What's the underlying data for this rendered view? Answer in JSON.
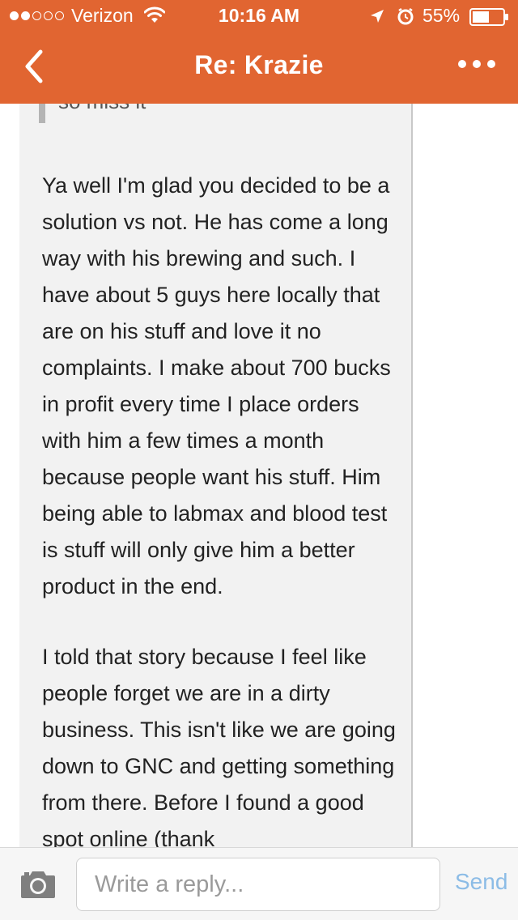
{
  "status_bar": {
    "signal_dots_filled": 2,
    "signal_dots_total": 5,
    "carrier": "Verizon",
    "time": "10:16 AM",
    "battery": "55%",
    "battery_level": 0.55
  },
  "nav": {
    "title": "Re: Krazie",
    "back_icon": "chevron-left-icon",
    "more_icon": "more-dots-icon"
  },
  "message": {
    "quoted_fragment": "so miss it",
    "paragraphs": [
      "Ya well I'm glad you decided to be a solution vs not. He has come a long way with his brewing and such. I have about 5 guys here locally that are on his stuff and love it no complaints. I make about 700 bucks in profit every time I place orders with him a few times a month because people want his stuff. Him being able to labmax and blood test is stuff will only give him a better product in the end.",
      "I told that story because I feel like people forget we are in a dirty business. This isn't like we are going down to GNC and getting something from there. Before I found a good spot online (thank"
    ]
  },
  "reply": {
    "placeholder": "Write a reply...",
    "send_label": "Send",
    "camera_icon": "camera-icon"
  },
  "colors": {
    "header": "#e16531",
    "bubble": "#f2f2f2",
    "send": "#8cbce6"
  }
}
